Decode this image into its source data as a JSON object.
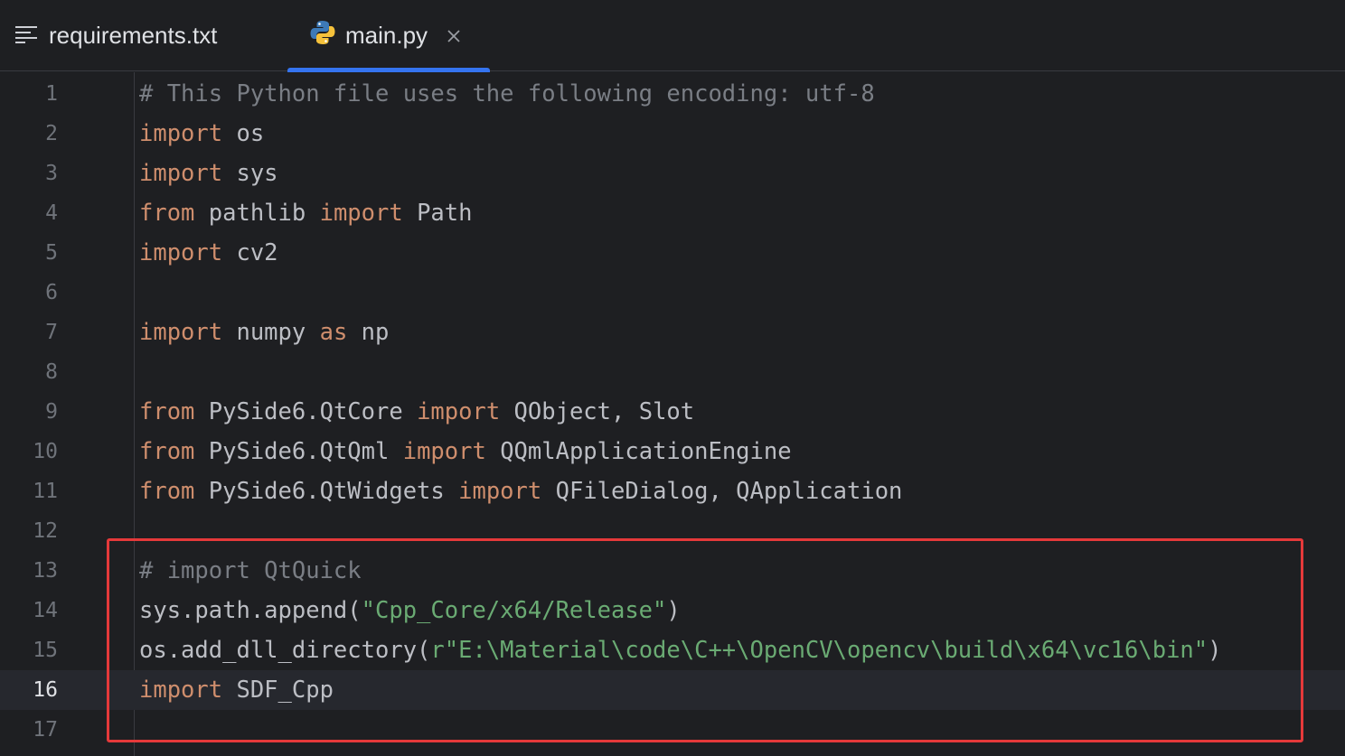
{
  "tabs": [
    {
      "label": "requirements.txt",
      "icon": "text-file-icon",
      "active": false
    },
    {
      "label": "main.py",
      "icon": "python-file-icon",
      "active": true
    }
  ],
  "colors": {
    "background": "#1e1f22",
    "keyword": "#cf8e6d",
    "comment": "#7a7e85",
    "string": "#6aab73",
    "identifier": "#bcbec4",
    "active_tab_underline": "#3574f0",
    "highlight_box": "#e5393a"
  },
  "current_line": 16,
  "lines": [
    {
      "num": "1",
      "tokens": [
        {
          "t": "cm",
          "v": "# This Python file uses the following encoding: utf-8"
        }
      ]
    },
    {
      "num": "2",
      "tokens": [
        {
          "t": "kw",
          "v": "import"
        },
        {
          "t": "id",
          "v": " os"
        }
      ]
    },
    {
      "num": "3",
      "tokens": [
        {
          "t": "kw",
          "v": "import"
        },
        {
          "t": "id",
          "v": " sys"
        }
      ]
    },
    {
      "num": "4",
      "tokens": [
        {
          "t": "kw",
          "v": "from"
        },
        {
          "t": "id",
          "v": " pathlib "
        },
        {
          "t": "kw",
          "v": "import"
        },
        {
          "t": "id",
          "v": " Path"
        }
      ]
    },
    {
      "num": "5",
      "tokens": [
        {
          "t": "kw",
          "v": "import"
        },
        {
          "t": "id",
          "v": " cv2"
        }
      ]
    },
    {
      "num": "6",
      "tokens": []
    },
    {
      "num": "7",
      "tokens": [
        {
          "t": "kw",
          "v": "import"
        },
        {
          "t": "id",
          "v": " numpy "
        },
        {
          "t": "kw",
          "v": "as"
        },
        {
          "t": "id",
          "v": " np"
        }
      ]
    },
    {
      "num": "8",
      "tokens": []
    },
    {
      "num": "9",
      "tokens": [
        {
          "t": "kw",
          "v": "from"
        },
        {
          "t": "id",
          "v": " PySide6.QtCore "
        },
        {
          "t": "kw",
          "v": "import"
        },
        {
          "t": "id",
          "v": " QObject, Slot"
        }
      ]
    },
    {
      "num": "10",
      "tokens": [
        {
          "t": "kw",
          "v": "from"
        },
        {
          "t": "id",
          "v": " PySide6.QtQml "
        },
        {
          "t": "kw",
          "v": "import"
        },
        {
          "t": "id",
          "v": " QQmlApplicationEngine"
        }
      ]
    },
    {
      "num": "11",
      "tokens": [
        {
          "t": "kw",
          "v": "from"
        },
        {
          "t": "id",
          "v": " PySide6.QtWidgets "
        },
        {
          "t": "kw",
          "v": "import"
        },
        {
          "t": "id",
          "v": " QFileDialog, QApplication"
        }
      ]
    },
    {
      "num": "12",
      "tokens": []
    },
    {
      "num": "13",
      "tokens": [
        {
          "t": "cm",
          "v": "# import QtQuick"
        }
      ]
    },
    {
      "num": "14",
      "tokens": [
        {
          "t": "id",
          "v": "sys.path.append("
        },
        {
          "t": "st",
          "v": "\"Cpp_Core/x64/Release\""
        },
        {
          "t": "id",
          "v": ")"
        }
      ]
    },
    {
      "num": "15",
      "tokens": [
        {
          "t": "id",
          "v": "os.add_dll_directory("
        },
        {
          "t": "st",
          "v": "r\"E:\\Material\\code\\C++\\OpenCV\\opencv\\build\\x64\\vc16\\bin\""
        },
        {
          "t": "id",
          "v": ")"
        }
      ]
    },
    {
      "num": "16",
      "tokens": [
        {
          "t": "kw",
          "v": "import"
        },
        {
          "t": "id",
          "v": " SDF_Cpp"
        }
      ]
    },
    {
      "num": "17",
      "tokens": []
    }
  ]
}
